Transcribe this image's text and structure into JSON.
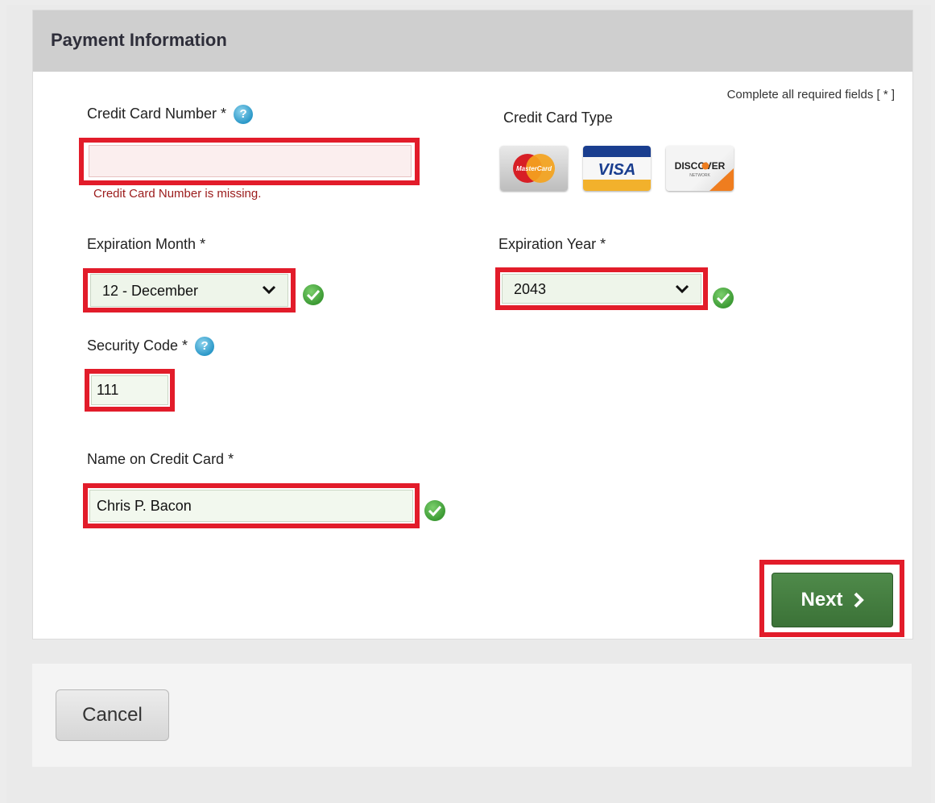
{
  "header": {
    "title": "Payment Information"
  },
  "required_note": "Complete all required fields [ * ]",
  "card_number": {
    "label": "Credit Card Number *",
    "value": "",
    "error": "Credit Card Number is missing."
  },
  "card_type": {
    "label": "Credit Card Type",
    "logos": [
      {
        "name": "MasterCard",
        "icon": "mastercard-logo"
      },
      {
        "name": "VISA",
        "icon": "visa-logo"
      },
      {
        "name": "DISCOVER",
        "icon": "discover-logo"
      }
    ]
  },
  "expiration_month": {
    "label": "Expiration Month *",
    "value": "12 - December"
  },
  "expiration_year": {
    "label": "Expiration Year *",
    "value": "2043"
  },
  "security_code": {
    "label": "Security Code *",
    "value": "111"
  },
  "name_on_card": {
    "label": "Name on Credit Card *",
    "value": "Chris P. Bacon"
  },
  "buttons": {
    "next": "Next",
    "cancel": "Cancel"
  },
  "colors": {
    "highlight": "#e21c2a",
    "next_button": "#3f7a3b",
    "error_text": "#9b1b1b",
    "valid_check": "#4caf3f"
  }
}
